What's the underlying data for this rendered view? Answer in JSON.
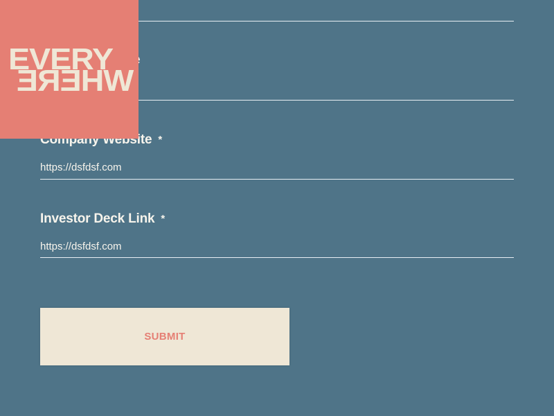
{
  "logo": {
    "line1": "EVERY",
    "line2": "WHERE"
  },
  "fields": [
    {
      "label": "Company Website",
      "required_mark": "*",
      "value": "https://dsfdsf.com"
    },
    {
      "label": "Investor Deck Link",
      "required_mark": "*",
      "value": "https://dsfdsf.com"
    }
  ],
  "partial_label_fragment": "e",
  "submit": {
    "label": "SUBMIT"
  },
  "colors": {
    "background": "#4f7488",
    "logo_bg": "#e57f74",
    "logo_text": "#efe7d6",
    "button_bg": "#efe7d6",
    "button_text": "#e57f74"
  }
}
